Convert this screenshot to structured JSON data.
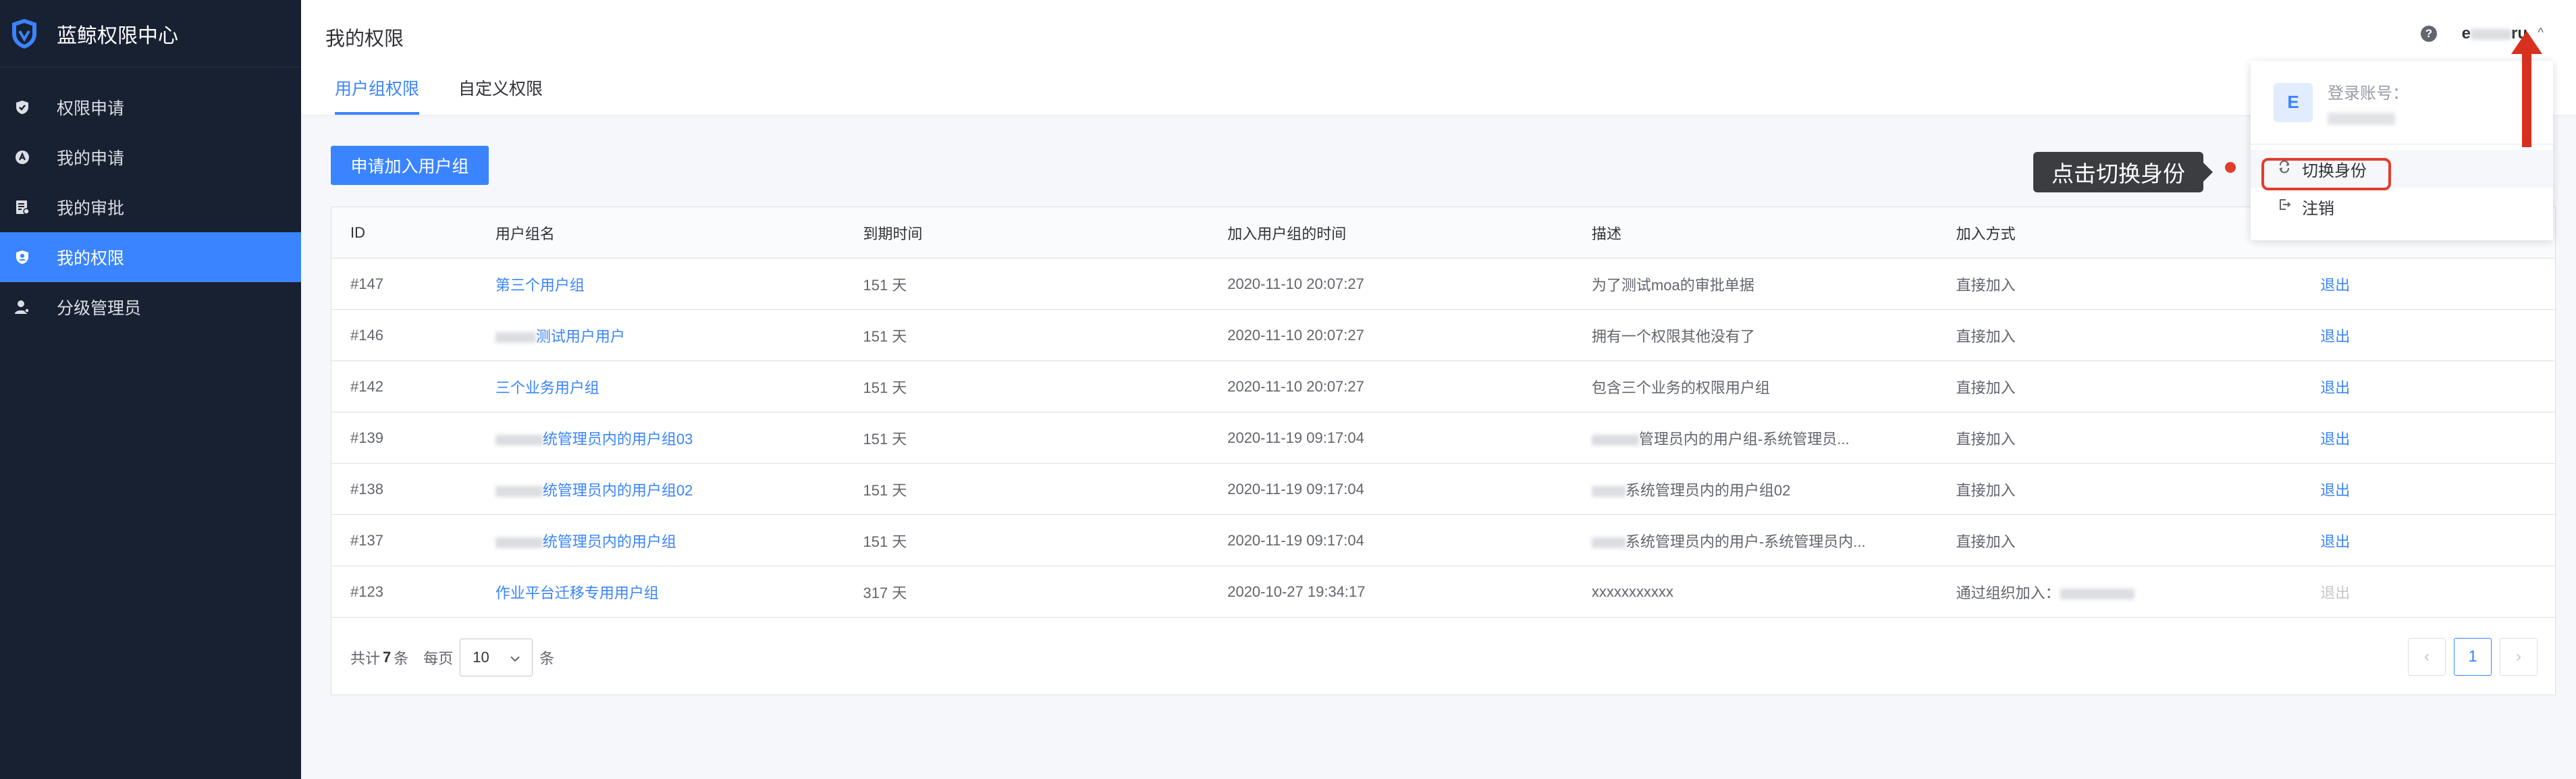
{
  "app": {
    "title": "蓝鲸权限中心"
  },
  "sidebar": {
    "items": [
      {
        "label": "权限申请",
        "icon": "shield-check-icon"
      },
      {
        "label": "我的申请",
        "icon": "apply-icon"
      },
      {
        "label": "我的审批",
        "icon": "approval-doc-icon"
      },
      {
        "label": "我的权限",
        "icon": "my-perm-icon",
        "active": true
      },
      {
        "label": "分级管理员",
        "icon": "admin-user-icon"
      }
    ]
  },
  "header": {
    "page_title": "我的权限",
    "tabs": [
      {
        "label": "用户组权限",
        "active": true
      },
      {
        "label": "自定义权限",
        "active": false
      }
    ],
    "help": "?",
    "user_prefix": "e",
    "user_suffix": "ru",
    "caret": "^"
  },
  "main": {
    "apply_button": "申请加入用户组",
    "table": {
      "headers": [
        "ID",
        "用户组名",
        "到期时间",
        "加入用户组的时间",
        "描述",
        "加入方式",
        ""
      ],
      "rows": [
        {
          "id": "#147",
          "name": "第三个用户组",
          "expire": "151 天",
          "joined": "2020-11-10 20:07:27",
          "desc": "为了测试moa的审批单据",
          "method": "直接加入",
          "action": "退出"
        },
        {
          "id": "#146",
          "name": "测试用户用户",
          "expire": "151 天",
          "joined": "2020-11-10 20:07:27",
          "desc": "拥有一个权限其他没有了",
          "method": "直接加入",
          "action": "退出"
        },
        {
          "id": "#142",
          "name": "三个业务用户组",
          "expire": "151 天",
          "joined": "2020-11-10 20:07:27",
          "desc": "包含三个业务的权限用户组",
          "method": "直接加入",
          "action": "退出"
        },
        {
          "id": "#139",
          "name": "统管理员内的用户组03",
          "expire": "151 天",
          "joined": "2020-11-19 09:17:04",
          "desc": "管理员内的用户组-系统管理员...",
          "method": "直接加入",
          "action": "退出"
        },
        {
          "id": "#138",
          "name": "统管理员内的用户组02",
          "expire": "151 天",
          "joined": "2020-11-19 09:17:04",
          "desc": "系统管理员内的用户组02",
          "method": "直接加入",
          "action": "退出"
        },
        {
          "id": "#137",
          "name": "统管理员内的用户组",
          "expire": "151 天",
          "joined": "2020-11-19 09:17:04",
          "desc": "系统管理员内的用户-系统管理员内...",
          "method": "直接加入",
          "action": "退出"
        },
        {
          "id": "#123",
          "name": "作业平台迁移专用用户组",
          "expire": "317 天",
          "joined": "2020-10-27 19:34:17",
          "desc": "xxxxxxxxxxx",
          "method": "通过组织加入：",
          "action": "退出",
          "disabled": true
        }
      ]
    },
    "pagination": {
      "total_prefix": "共计",
      "total": "7",
      "total_suffix": "条",
      "per_page_label": "每页",
      "page_size": "10",
      "per_page_suffix": "条",
      "current_page": "1",
      "prev": "‹",
      "next": "›"
    }
  },
  "dropdown": {
    "avatar_letter": "E",
    "account_label": "登录账号：",
    "items": [
      {
        "label": "切换身份",
        "icon": "switch-icon"
      },
      {
        "label": "注销",
        "icon": "logout-icon"
      }
    ]
  },
  "annotation": {
    "callout": "点击切换身份",
    "color": "#e23c2b"
  },
  "colors": {
    "primary": "#3a84ff",
    "sidebar_bg": "#182132",
    "danger": "#e23c2b"
  }
}
